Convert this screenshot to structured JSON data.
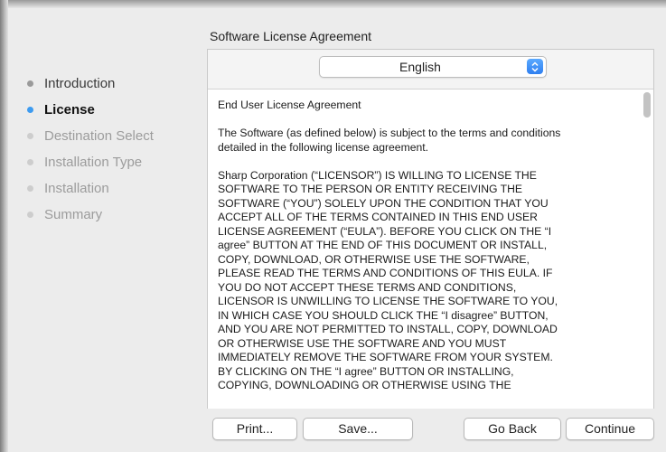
{
  "sidebar": {
    "steps": [
      {
        "label": "Introduction",
        "state": "done"
      },
      {
        "label": "License",
        "state": "current"
      },
      {
        "label": "Destination Select",
        "state": "pending"
      },
      {
        "label": "Installation Type",
        "state": "pending"
      },
      {
        "label": "Installation",
        "state": "pending"
      },
      {
        "label": "Summary",
        "state": "pending"
      }
    ]
  },
  "main": {
    "section_title": "Software License Agreement",
    "language": {
      "selected": "English",
      "icon": "up-down-chevron-icon"
    },
    "license_paragraphs": [
      "End User License Agreement",
      "The Software (as defined below) is subject to the terms and conditions\ndetailed in the following license agreement.",
      "Sharp Corporation (“LICENSOR”) IS WILLING TO LICENSE THE\nSOFTWARE TO THE PERSON OR ENTITY RECEIVING THE\nSOFTWARE (“YOU”) SOLELY UPON THE CONDITION THAT YOU\nACCEPT ALL OF THE TERMS CONTAINED IN THIS END USER\nLICENSE AGREEMENT (“EULA”).  BEFORE YOU CLICK ON THE “I\nagree” BUTTON AT THE END OF THIS DOCUMENT OR INSTALL,\nCOPY, DOWNLOAD, OR OTHERWISE USE THE SOFTWARE,\nPLEASE READ THE TERMS AND CONDITIONS OF THIS EULA.  IF\nYOU DO NOT ACCEPT THESE TERMS AND CONDITIONS,\nLICENSOR IS UNWILLING TO LICENSE THE SOFTWARE TO YOU,\nIN WHICH CASE YOU SHOULD CLICK THE “I disagree” BUTTON,\nAND YOU ARE NOT PERMITTED TO INSTALL, COPY, DOWNLOAD\nOR OTHERWISE USE THE SOFTWARE AND YOU MUST\nIMMEDIATELY REMOVE THE SOFTWARE FROM YOUR SYSTEM.\nBY CLICKING ON THE “I agree” BUTTON OR INSTALLING,\nCOPYING, DOWNLOADING OR OTHERWISE USING THE"
    ]
  },
  "buttons": {
    "print": "Print...",
    "save": "Save...",
    "go_back": "Go Back",
    "continue": "Continue"
  },
  "colors": {
    "accent": "#3d9bf0",
    "window_bg": "#ececec"
  }
}
